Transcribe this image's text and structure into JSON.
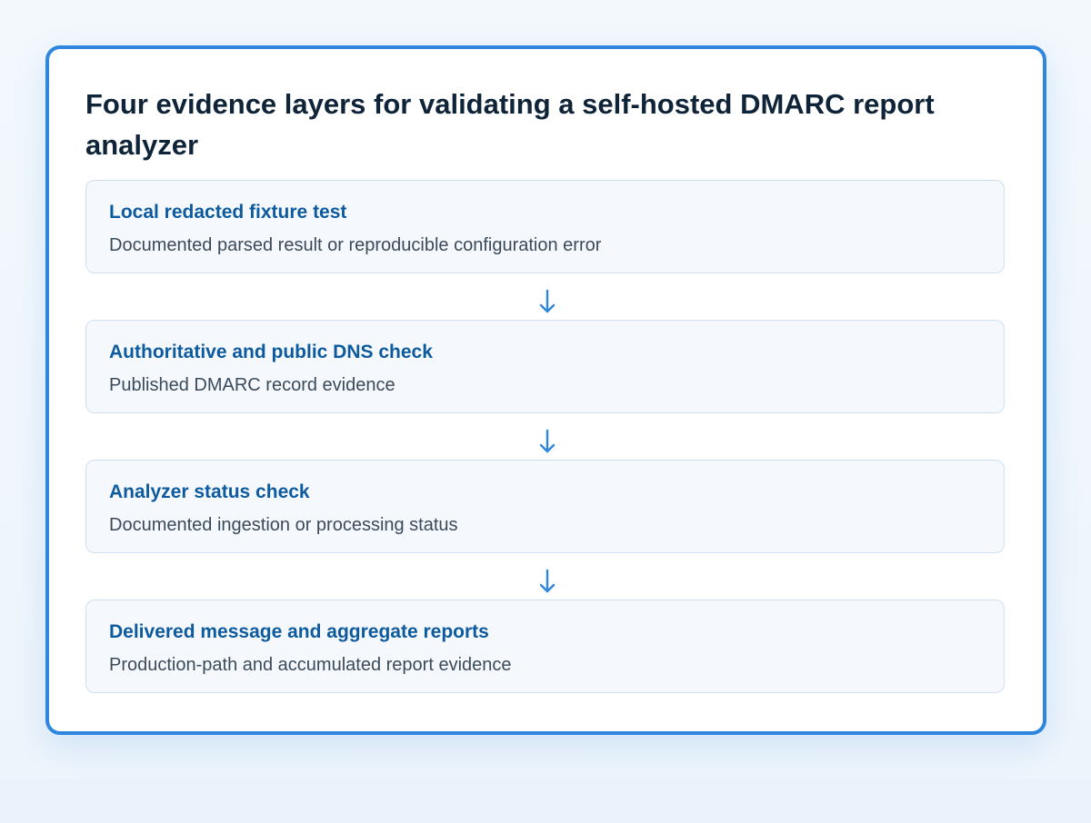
{
  "diagram": {
    "title": "Four evidence layers for validating a self-hosted DMARC report analyzer",
    "layers": [
      {
        "title": "Local redacted fixture test",
        "description": "Documented parsed result or reproducible configuration error"
      },
      {
        "title": "Authoritative and public DNS check",
        "description": "Published DMARC record evidence"
      },
      {
        "title": "Analyzer status check",
        "description": "Documented ingestion or processing status"
      },
      {
        "title": "Delivered message and aggregate reports",
        "description": "Production-path and accumulated report evidence"
      }
    ],
    "colors": {
      "border": "#2e86de",
      "arrow": "#2e86de",
      "layer_title": "#0d5a9e",
      "title": "#0f2438"
    }
  }
}
